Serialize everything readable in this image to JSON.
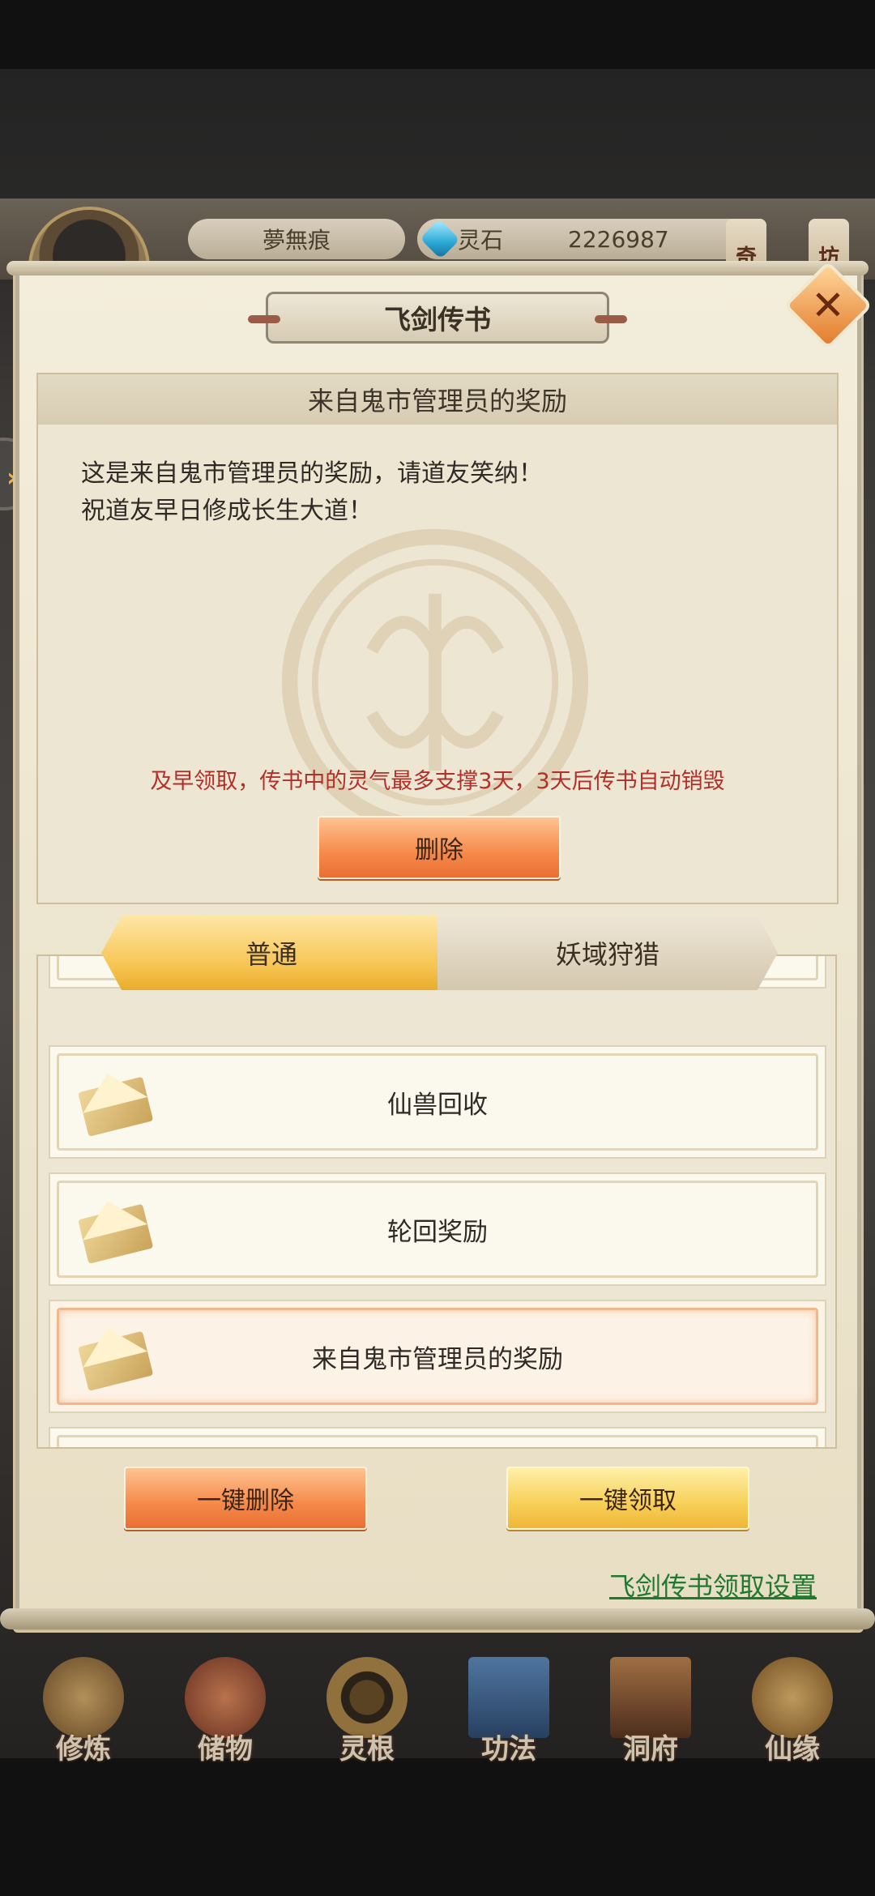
{
  "hud": {
    "player_name": "夢無痕",
    "stone_label": "灵石",
    "stone_amount": "2226987",
    "tag_left": "奇",
    "tag_right": "坊"
  },
  "dialog": {
    "title": "飞剑传书",
    "close_icon": "close-icon"
  },
  "mail_detail": {
    "subject": "来自鬼市管理员的奖励",
    "body_lines": [
      "这是来自鬼市管理员的奖励，请道友笑纳！",
      "祝道友早日修成长生大道！"
    ],
    "warning": "及早领取，传书中的灵气最多支撑3天，3天后传书自动销毁",
    "delete_label": "删除"
  },
  "tabs": [
    {
      "label": "普通",
      "active": true
    },
    {
      "label": "妖域狩猎",
      "active": false
    }
  ],
  "mail_list": [
    {
      "title": "仙兽回收",
      "selected": false
    },
    {
      "title": "轮回奖励",
      "selected": false
    },
    {
      "title": "来自鬼市管理员的奖励",
      "selected": true
    }
  ],
  "actions": {
    "delete_all": "一键删除",
    "claim_all": "一键领取",
    "settings_link": "飞剑传书领取设置"
  },
  "bottom_nav": [
    {
      "label": "修炼",
      "icon": "cultivate-icon",
      "color": "#c79a52"
    },
    {
      "label": "储物",
      "icon": "storage-bag-icon",
      "color": "#c8643a"
    },
    {
      "label": "灵根",
      "icon": "spirit-root-icon",
      "color": "#8f6a35"
    },
    {
      "label": "功法",
      "icon": "book-icon",
      "color": "#3b6aa1"
    },
    {
      "label": "洞府",
      "icon": "cave-house-icon",
      "color": "#9b5b2f"
    },
    {
      "label": "仙缘",
      "icon": "gourd-icon",
      "color": "#d99b3d"
    }
  ]
}
